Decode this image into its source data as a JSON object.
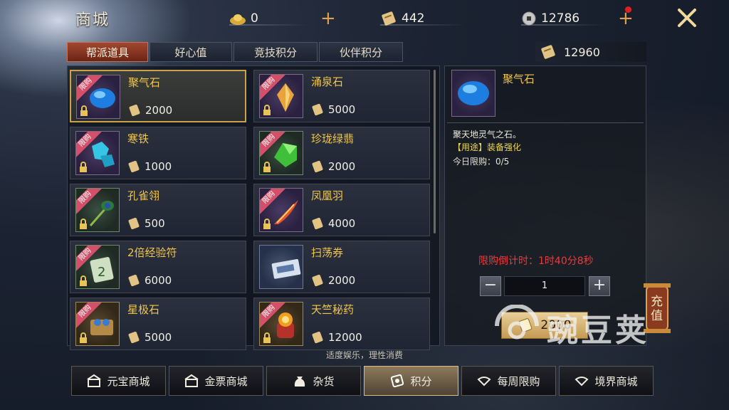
{
  "header": {
    "title": "商城",
    "gold": "0",
    "tickets": "442",
    "coins": "12786"
  },
  "tabs": [
    {
      "label": "帮派道具",
      "active": true
    },
    {
      "label": "好心值",
      "active": false
    },
    {
      "label": "竞技积分",
      "active": false
    },
    {
      "label": "伙伴积分",
      "active": false
    }
  ],
  "points_balance": "12960",
  "items": [
    {
      "name": "聚气石",
      "price": "2000",
      "badge": "限购",
      "icon": "blue-gem-icon"
    },
    {
      "name": "涌泉石",
      "price": "5000",
      "badge": "限购",
      "icon": "amber-crystal-icon"
    },
    {
      "name": "寒铁",
      "price": "1000",
      "badge": "限购",
      "icon": "cyan-ore-icon"
    },
    {
      "name": "珍珑绿翡",
      "price": "2000",
      "badge": "限购",
      "icon": "green-jade-icon"
    },
    {
      "name": "孔雀翎",
      "price": "500",
      "badge": "限购",
      "icon": "peacock-feather-icon"
    },
    {
      "name": "凤凰羽",
      "price": "4000",
      "badge": "限购",
      "icon": "phoenix-feather-icon"
    },
    {
      "name": "2倍经验符",
      "price": "6000",
      "badge": "限购",
      "icon": "exp-talisman-icon"
    },
    {
      "name": "扫荡券",
      "price": "2000",
      "badge": "",
      "icon": "sweep-ticket-icon"
    },
    {
      "name": "星极石",
      "price": "5000",
      "badge": "限购",
      "icon": "star-chest-icon"
    },
    {
      "name": "天竺秘药",
      "price": "12000",
      "badge": "限购",
      "icon": "elixir-jar-icon"
    }
  ],
  "detail": {
    "name": "聚气石",
    "description": "聚天地灵气之石。",
    "usage": "【用途】装备强化",
    "daily_limit": "今日限购：0/5",
    "countdown": "限购倒计时：1时40分8秒",
    "quantity": "1",
    "price": "2000"
  },
  "recharge_label": "充值",
  "notice": "适度娱乐，理性消费",
  "bottom_nav": [
    {
      "label": "元宝商城",
      "active": false
    },
    {
      "label": "金票商城",
      "active": false
    },
    {
      "label": "杂货",
      "active": false
    },
    {
      "label": "积分",
      "active": true
    },
    {
      "label": "每周限购",
      "active": false
    },
    {
      "label": "境界商城",
      "active": false
    }
  ],
  "watermark": "豌豆荚",
  "colors": {
    "accent": "#f2c649",
    "tab_active": "#a2472f",
    "countdown": "#ea3b3b",
    "badge": "#d4506a"
  }
}
